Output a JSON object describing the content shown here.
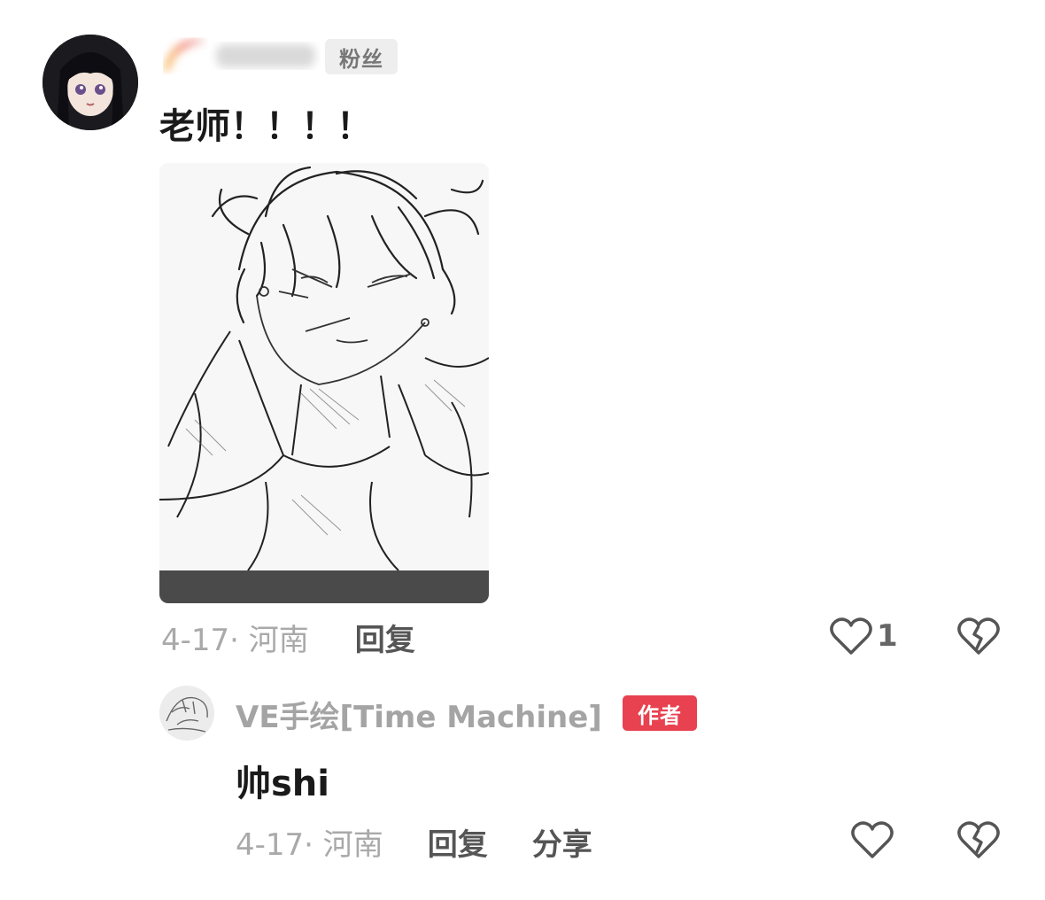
{
  "comment": {
    "username": "",
    "fan_badge": "粉丝",
    "text": "老师！！！！",
    "date_location": "4-17· 河南",
    "reply_label": "回复",
    "like_count": "1",
    "like_icon": "heart-outline-icon",
    "dislike_icon": "broken-heart-icon"
  },
  "reply": {
    "username": "VE手绘[Time Machine]",
    "author_badge": "作者",
    "text": "帅shi",
    "date_location": "4-17· 河南",
    "reply_label": "回复",
    "share_label": "分享",
    "like_icon": "heart-outline-icon",
    "dislike_icon": "broken-heart-icon"
  },
  "colors": {
    "author_badge_bg": "#e8414f",
    "fan_badge_bg": "#eeeeee",
    "meta_text": "#a9a9a9",
    "action_text": "#555555"
  }
}
